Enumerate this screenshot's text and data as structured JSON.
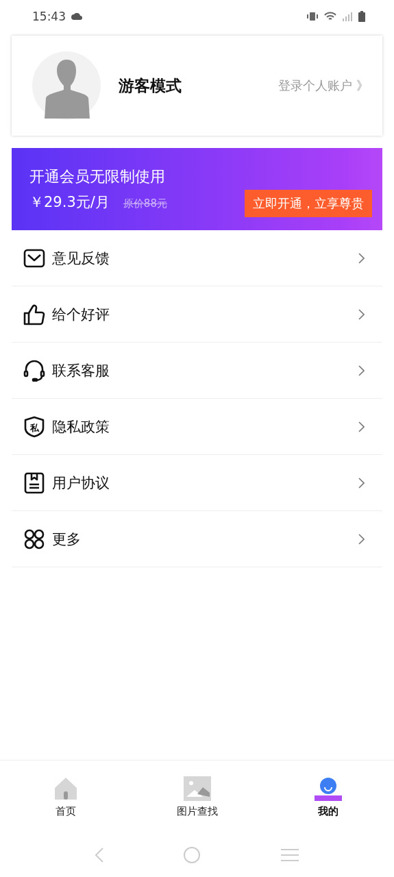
{
  "status_bar": {
    "time": "15:43"
  },
  "profile": {
    "name": "游客模式",
    "login_link": "登录个人账户 》"
  },
  "vip_banner": {
    "title": "开通会员无限制使用",
    "price": "￥29.3元/月",
    "original_price": "原价88元",
    "button": "立即开通，立享尊贵"
  },
  "menu": [
    {
      "kind": "mail",
      "label": "意见反馈"
    },
    {
      "kind": "thumb",
      "label": "给个好评"
    },
    {
      "kind": "headset",
      "label": "联系客服"
    },
    {
      "kind": "shield",
      "label": "隐私政策",
      "icon_glyph": "私"
    },
    {
      "kind": "document",
      "label": "用户协议"
    },
    {
      "kind": "more",
      "label": "更多"
    }
  ],
  "tabs": [
    {
      "kind": "home",
      "label": "首页",
      "selected": false
    },
    {
      "kind": "image",
      "label": "图片查找",
      "selected": false
    },
    {
      "kind": "user",
      "label": "我的",
      "selected": true
    }
  ]
}
